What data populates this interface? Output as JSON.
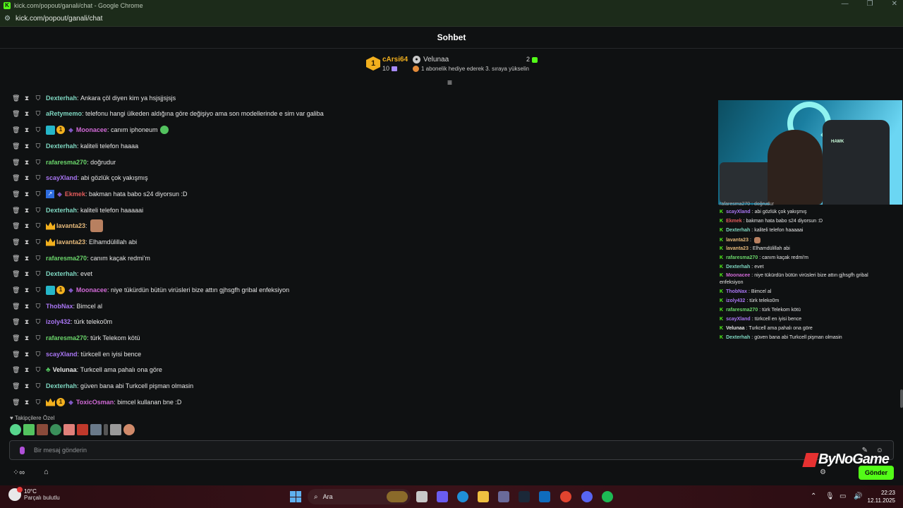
{
  "window": {
    "title": "kick.com/popout/ganali/chat - Google Chrome",
    "url": "kick.com/popout/ganali/chat",
    "controls": [
      "—",
      "❐",
      "✕"
    ]
  },
  "chat_header": {
    "title": "Sohbet"
  },
  "leaderboard": {
    "rank": "1",
    "top_user": "cArsi64",
    "top_count": "10",
    "second_user": "Velunaa",
    "second_count": "2",
    "promo": "1 abonelik hediye ederek 3. sıraya yükselin"
  },
  "messages": [
    {
      "user": "Dexterhah",
      "text": "Ankara çöl diyen kim ya hsjsjjsjsjs",
      "color": "#7ed6c0",
      "badges": []
    },
    {
      "user": "aRetymemo",
      "text": "telefonu hangi ülkeden aldığına göre değişiyo ama son modellerinde e sim var galiba",
      "color": "#7ed6c0",
      "badges": []
    },
    {
      "user": "Moonacee",
      "text": "canım iphoneum",
      "color": "#d16ad6",
      "badges": [
        "blue-badge",
        "gold-1",
        "purple-bird"
      ],
      "emote": "green-heart"
    },
    {
      "user": "Dexterhah",
      "text": "kaliteli telefon haaaa",
      "color": "#7ed6c0",
      "badges": []
    },
    {
      "user": "rafaresma270",
      "text": "doğrudur",
      "color": "#6bd66b",
      "badges": []
    },
    {
      "user": "scayXland",
      "text": "abi gözlük çok yakışmış",
      "color": "#a875f2",
      "badges": []
    },
    {
      "user": "Ekmek",
      "text": "bakman hata babo s24 diyorsun :D",
      "color": "#e35b5b",
      "badges": [
        "arrow-badge",
        "purple-bird"
      ]
    },
    {
      "user": "Dexterhah",
      "text": "kaliteli telefon haaaaai",
      "color": "#7ed6c0",
      "badges": []
    },
    {
      "user": "lavanta23",
      "text": "",
      "color": "#e5b97a",
      "badges": [
        "crown"
      ],
      "emote": "face"
    },
    {
      "user": "lavanta23",
      "text": "Elhamdülillah abi",
      "color": "#e5b97a",
      "badges": [
        "crown"
      ]
    },
    {
      "user": "rafaresma270",
      "text": "canım kaçak redmi'm",
      "color": "#6bd66b",
      "badges": []
    },
    {
      "user": "Dexterhah",
      "text": "evet",
      "color": "#7ed6c0",
      "badges": []
    },
    {
      "user": "Moonacee",
      "text": "niye tükürdün bütün virüsleri bize attın gjhsgfh gribal enfeksiyon",
      "color": "#d16ad6",
      "badges": [
        "blue-badge",
        "gold-1",
        "purple-bird"
      ]
    },
    {
      "user": "ThobNax",
      "text": "Bimcel al",
      "color": "#a875f2",
      "badges": []
    },
    {
      "user": "izoly432",
      "text": "türk teleko0m",
      "color": "#a875f2",
      "badges": []
    },
    {
      "user": "rafaresma270",
      "text": "türk Telekom kötü",
      "color": "#6bd66b",
      "badges": []
    },
    {
      "user": "scayXland",
      "text": "türkcell en iyisi bence",
      "color": "#a875f2",
      "badges": []
    },
    {
      "user": "Velunaa",
      "text": "Turkcell ama pahalı ona göre",
      "color": "#e6e6e6",
      "badges": [
        "clover"
      ]
    },
    {
      "user": "Dexterhah",
      "text": "güven bana abi Turkcell pişman olmasin",
      "color": "#7ed6c0",
      "badges": []
    },
    {
      "user": "ToxicOsman",
      "text": "bimcel kullanan bne :D",
      "color": "#d16ad6",
      "badges": [
        "crown",
        "gold-1",
        "purple-bird"
      ]
    }
  ],
  "emotes_section": {
    "label": "Takipçilere Özel"
  },
  "input": {
    "placeholder": "Bir mesaj gönderin"
  },
  "send_button": {
    "label": "Gönder"
  },
  "overlay": {
    "partial_line": "rafaresma270 : doğrudur",
    "messages": [
      {
        "user": "scayXland",
        "text": "abi gözlük çok yakışmış",
        "color": "#a875f2"
      },
      {
        "user": "Ekmek",
        "text": "bakman hata babo s24 diyorsun :D",
        "color": "#e35b5b"
      },
      {
        "user": "Dexterhah",
        "text": "kaliteli telefon haaaaai",
        "color": "#7ed6c0"
      },
      {
        "user": "lavanta23",
        "text": "",
        "color": "#e5b97a"
      },
      {
        "user": "lavanta23",
        "text": "Elhamdülillah abi",
        "color": "#e5b97a"
      },
      {
        "user": "rafaresma270",
        "text": "canım kaçak redmi'm",
        "color": "#6bd66b"
      },
      {
        "user": "Dexterhah",
        "text": "evet",
        "color": "#7ed6c0"
      },
      {
        "user": "Moonacee",
        "text": "niye tükürdün bütün virüsleri bize attın gjhsgfh gribal",
        "color": "#d16ad6"
      },
      {
        "user": "",
        "text": "enfeksiyon",
        "color": "#e6e6e6"
      },
      {
        "user": "ThobNax",
        "text": "Bimcel al",
        "color": "#a875f2"
      },
      {
        "user": "izoly432",
        "text": "türk teleko0m",
        "color": "#a875f2"
      },
      {
        "user": "rafaresma270",
        "text": "türk Telekom kötü",
        "color": "#6bd66b"
      },
      {
        "user": "scayXland",
        "text": "türkcell en iyisi bence",
        "color": "#a875f2"
      },
      {
        "user": "Velunaa",
        "text": "Turkcell ama pahalı ona göre",
        "color": "#e6e6e6"
      },
      {
        "user": "Dexterhah",
        "text": "güven bana abi Turkcell pişman olmasin",
        "color": "#7ed6c0"
      }
    ],
    "cam_label": "HAWK"
  },
  "watermark": {
    "text": "ByNoGame"
  },
  "taskbar": {
    "temperature": "10°C",
    "weather": "Parçalı bulutlu",
    "search": "Ara",
    "time": "22:23",
    "date": "12.11.2025"
  }
}
